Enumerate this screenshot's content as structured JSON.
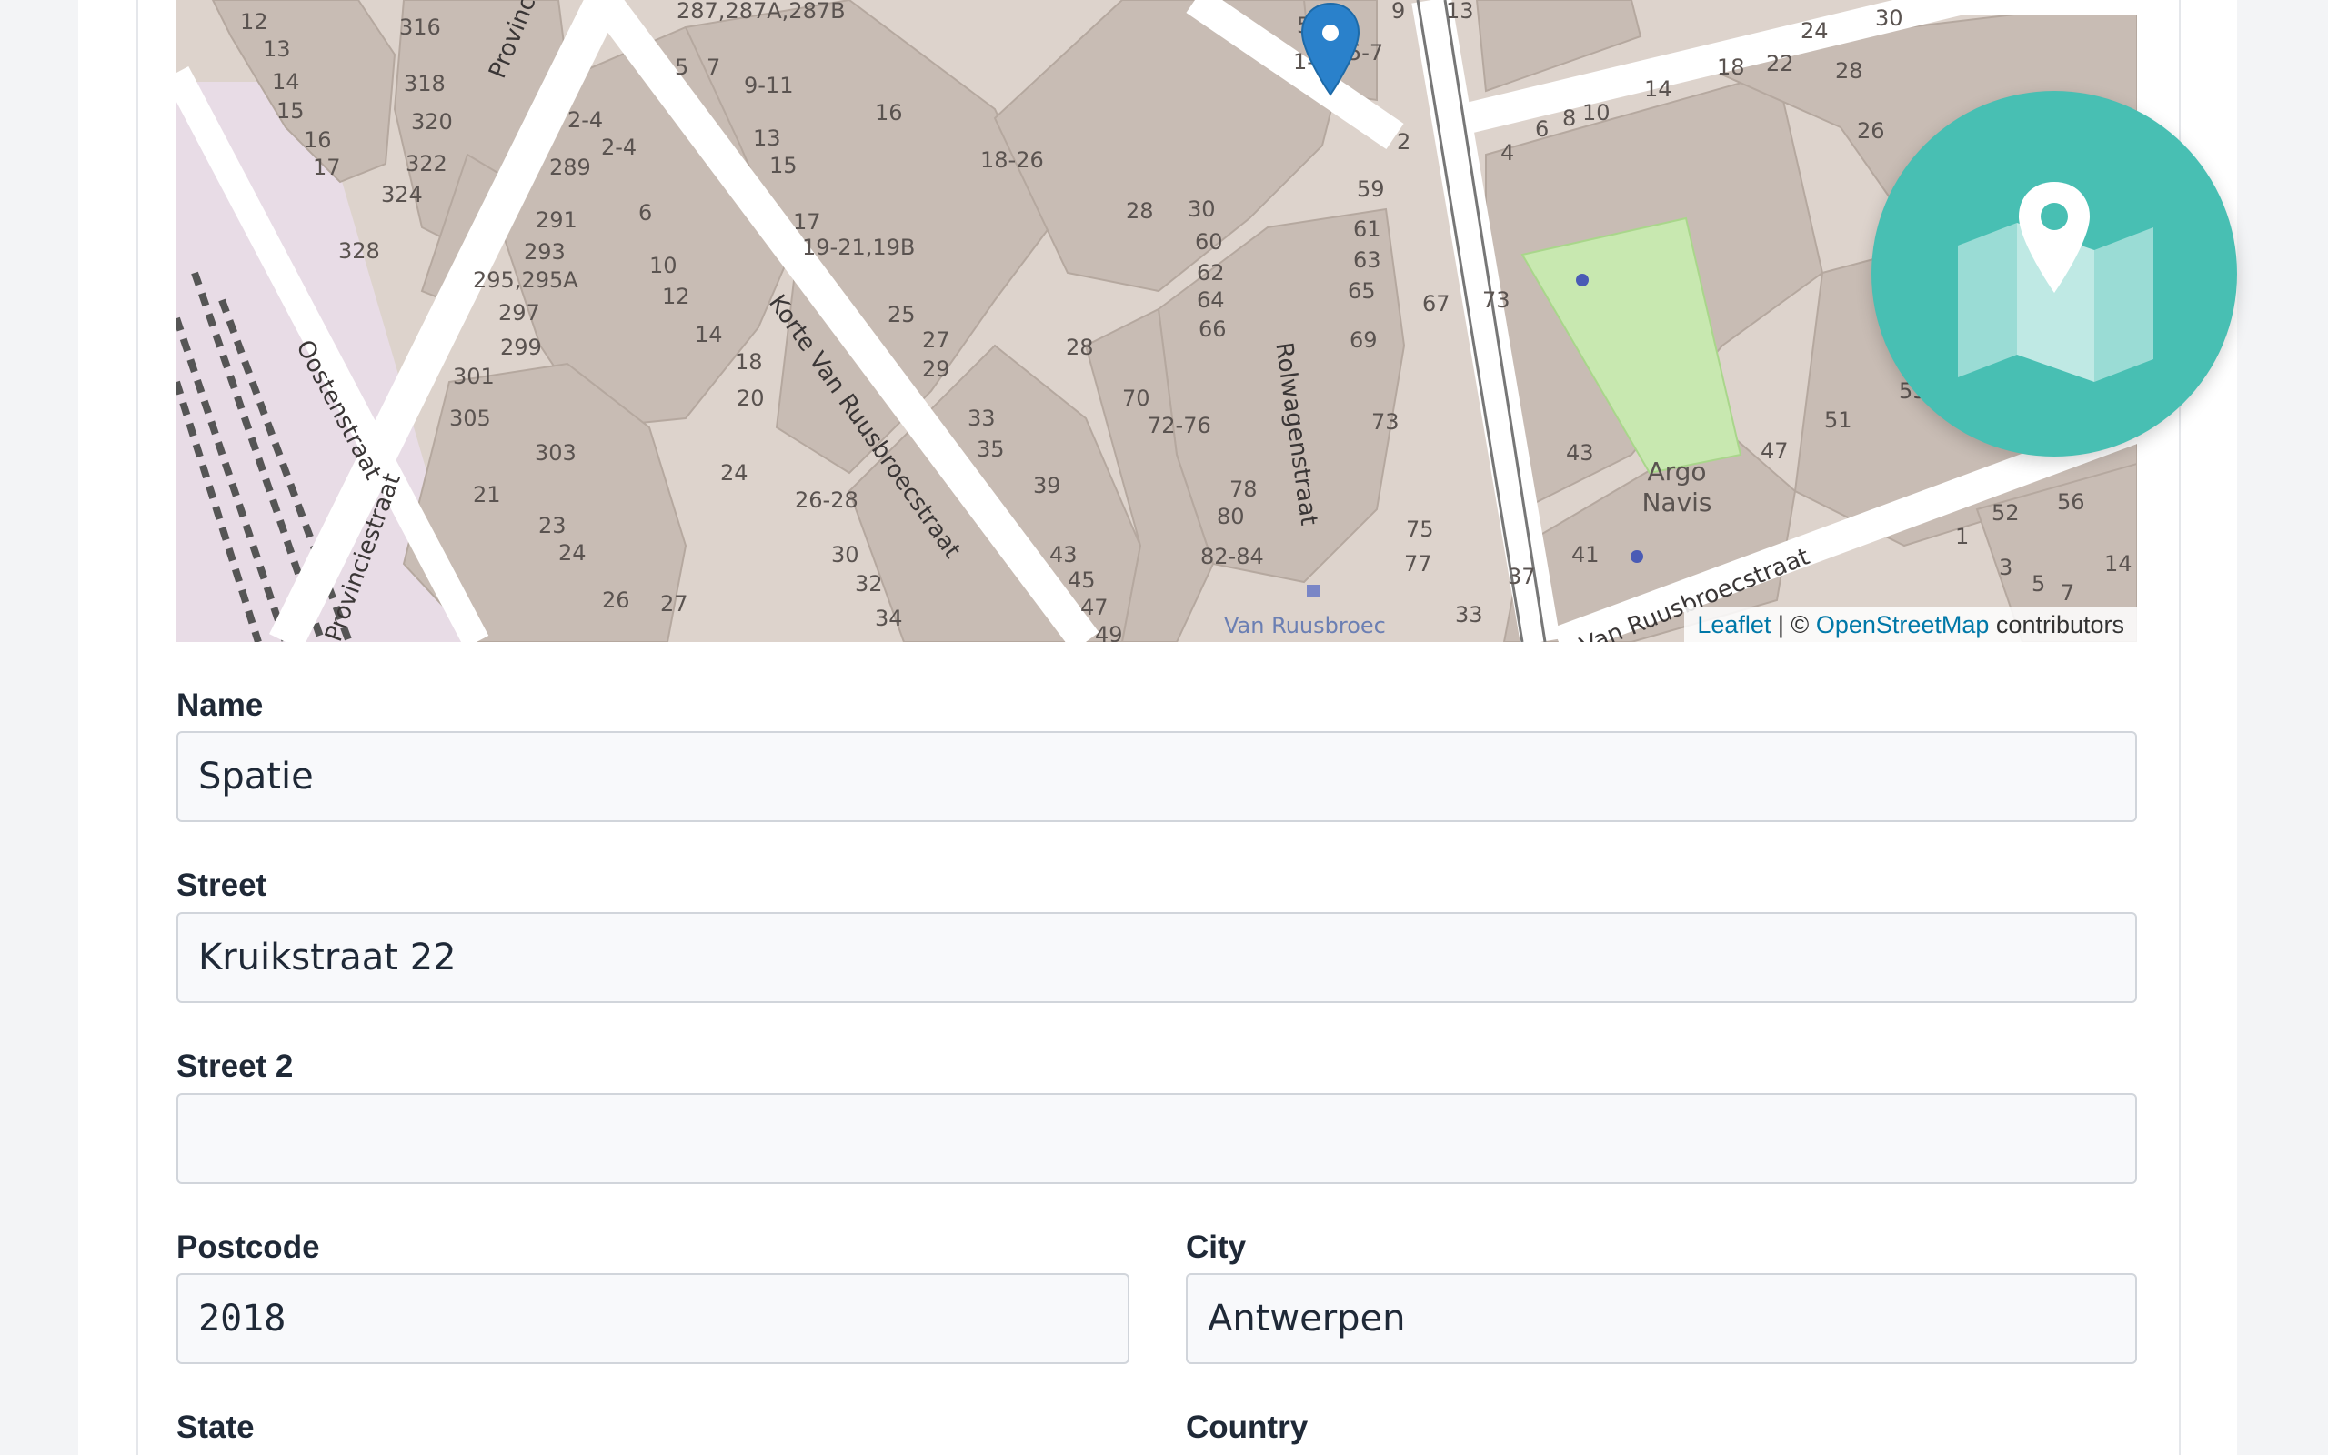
{
  "map": {
    "house_numbers": [
      {
        "t": "12"
      },
      {
        "t": "13"
      },
      {
        "t": "14"
      },
      {
        "t": "15"
      },
      {
        "t": "16"
      },
      {
        "t": "17"
      },
      {
        "t": "316"
      },
      {
        "t": "318"
      },
      {
        "t": "320"
      },
      {
        "t": "322"
      },
      {
        "t": "324"
      },
      {
        "t": "328"
      },
      {
        "t": "287,287A,287B"
      },
      {
        "t": "5"
      },
      {
        "t": "7"
      },
      {
        "t": "9-11"
      },
      {
        "t": "16"
      },
      {
        "t": "13"
      },
      {
        "t": "15"
      },
      {
        "t": "2-4"
      },
      {
        "t": "2-4"
      },
      {
        "t": "289"
      },
      {
        "t": "6"
      },
      {
        "t": "291"
      },
      {
        "t": "293"
      },
      {
        "t": "295,295A"
      },
      {
        "t": "10"
      },
      {
        "t": "12"
      },
      {
        "t": "297"
      },
      {
        "t": "14"
      },
      {
        "t": "299"
      },
      {
        "t": "18"
      },
      {
        "t": "301"
      },
      {
        "t": "20"
      },
      {
        "t": "305"
      },
      {
        "t": "303"
      },
      {
        "t": "24"
      },
      {
        "t": "21"
      },
      {
        "t": "23"
      },
      {
        "t": "24"
      },
      {
        "t": "26"
      },
      {
        "t": "27"
      },
      {
        "t": "17"
      },
      {
        "t": "19-21,19B"
      },
      {
        "t": "18-26"
      },
      {
        "t": "25"
      },
      {
        "t": "27"
      },
      {
        "t": "29"
      },
      {
        "t": "26-28"
      },
      {
        "t": "30"
      },
      {
        "t": "32"
      },
      {
        "t": "34"
      },
      {
        "t": "33"
      },
      {
        "t": "35"
      },
      {
        "t": "39"
      },
      {
        "t": "43"
      },
      {
        "t": "45"
      },
      {
        "t": "47"
      },
      {
        "t": "49"
      },
      {
        "t": "28"
      },
      {
        "t": "28"
      },
      {
        "t": "30"
      },
      {
        "t": "60"
      },
      {
        "t": "62"
      },
      {
        "t": "64"
      },
      {
        "t": "66"
      },
      {
        "t": "70"
      },
      {
        "t": "72-76"
      },
      {
        "t": "78"
      },
      {
        "t": "80"
      },
      {
        "t": "82-84"
      },
      {
        "t": "55"
      },
      {
        "t": "1-3"
      },
      {
        "t": "5-7"
      },
      {
        "t": "9"
      },
      {
        "t": "13"
      },
      {
        "t": "2"
      },
      {
        "t": "4"
      },
      {
        "t": "6"
      },
      {
        "t": "8"
      },
      {
        "t": "10"
      },
      {
        "t": "14"
      },
      {
        "t": "18"
      },
      {
        "t": "22"
      },
      {
        "t": "24"
      },
      {
        "t": "28"
      },
      {
        "t": "30"
      },
      {
        "t": "26"
      },
      {
        "t": "59"
      },
      {
        "t": "61"
      },
      {
        "t": "63"
      },
      {
        "t": "65"
      },
      {
        "t": "67"
      },
      {
        "t": "73"
      },
      {
        "t": "69"
      },
      {
        "t": "73"
      },
      {
        "t": "75"
      },
      {
        "t": "77"
      },
      {
        "t": "37"
      },
      {
        "t": "41"
      },
      {
        "t": "43"
      },
      {
        "t": "47"
      },
      {
        "t": "51"
      },
      {
        "t": "55"
      },
      {
        "t": "33"
      },
      {
        "t": "52"
      },
      {
        "t": "56"
      },
      {
        "t": "1"
      },
      {
        "t": "3"
      },
      {
        "t": "5"
      },
      {
        "t": "7"
      },
      {
        "t": "14"
      }
    ],
    "streets": [
      {
        "t": "Provinciestraat"
      },
      {
        "t": "Oostenstraat"
      },
      {
        "t": "Korte Van Ruusbroecstraat"
      },
      {
        "t": "Rolwagenstraat"
      },
      {
        "t": "Van Ruusbroecstraat"
      },
      {
        "t": "Provinciestraat"
      }
    ],
    "poi_name": "Argo Navis",
    "station_name": "Van Ruusbroec",
    "attribution": {
      "leaflet": "Leaflet",
      "separator": " | © ",
      "osm": "OpenStreetMap",
      "suffix": " contributors"
    },
    "marker_icon": "map-pin-icon",
    "badge_icon": "map-icon",
    "colors": {
      "land": "#ddd3cc",
      "building": "#c8bcb4",
      "road": "#ffffff",
      "rail_area": "#e8dce6",
      "park": "#c8e8b0",
      "badge": "#48bfb3",
      "marker": "#2a81cb"
    }
  },
  "form": {
    "name": {
      "label": "Name",
      "value": "Spatie"
    },
    "street": {
      "label": "Street",
      "value": "Kruikstraat 22"
    },
    "street2": {
      "label": "Street 2",
      "value": ""
    },
    "postcode": {
      "label": "Postcode",
      "value": "2018"
    },
    "city": {
      "label": "City",
      "value": "Antwerpen"
    },
    "state": {
      "label": "State"
    },
    "country": {
      "label": "Country"
    }
  }
}
